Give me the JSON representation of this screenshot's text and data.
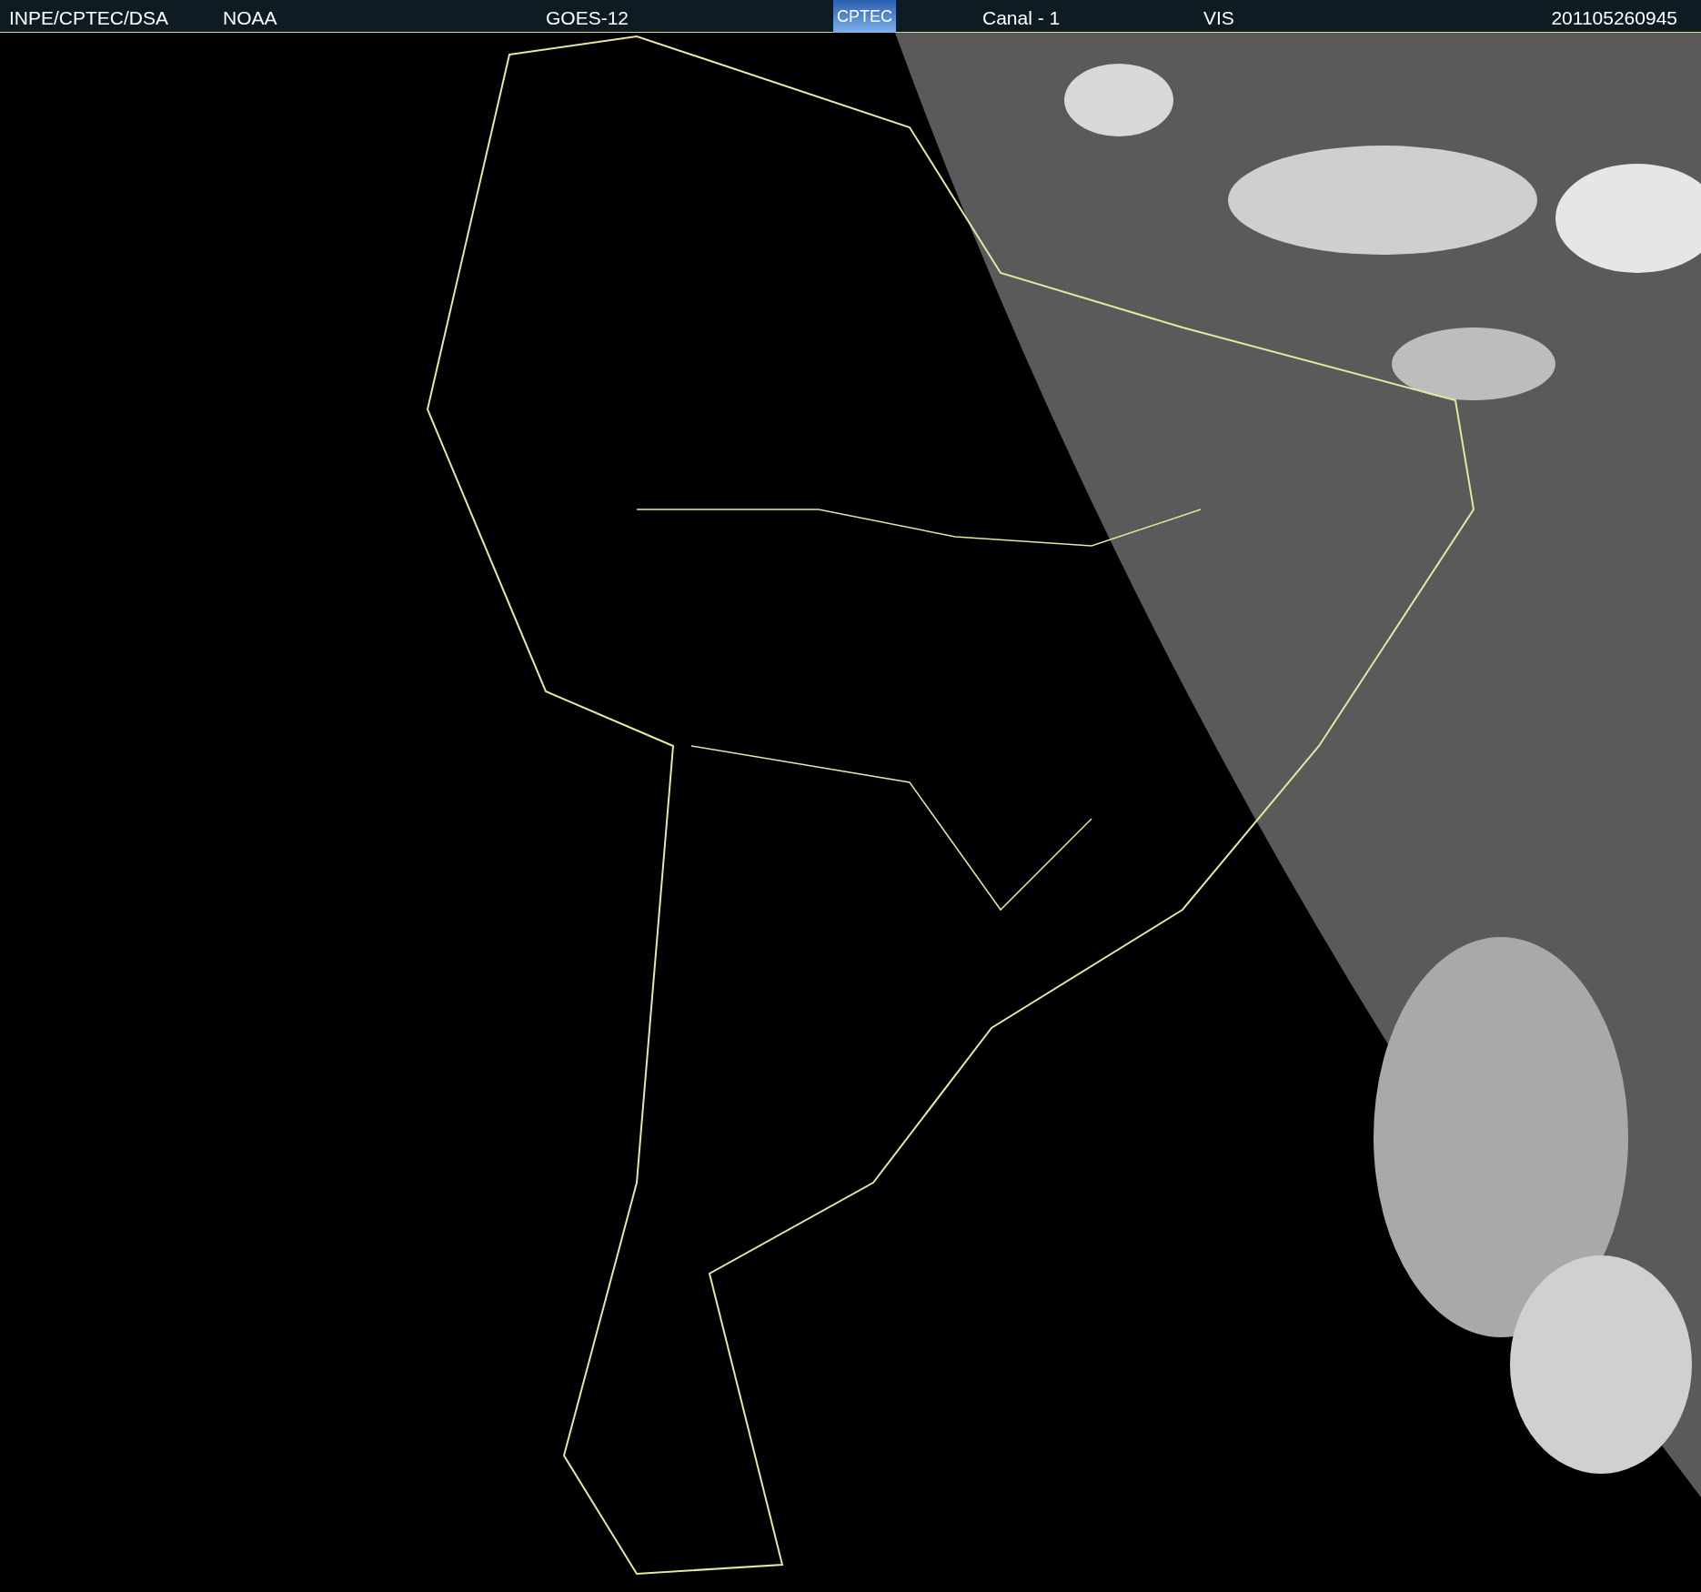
{
  "header": {
    "items": [
      {
        "kind": "text",
        "text": "INPE/CPTEC/DSA"
      },
      {
        "kind": "text",
        "text": "NOAA"
      },
      {
        "kind": "text",
        "text": "GOES-12"
      },
      {
        "kind": "logo",
        "text": "CPTEC"
      },
      {
        "kind": "text",
        "text": "Canal - 1"
      },
      {
        "kind": "text",
        "text": "VIS"
      },
      {
        "kind": "text",
        "text": "201105260945"
      }
    ]
  }
}
